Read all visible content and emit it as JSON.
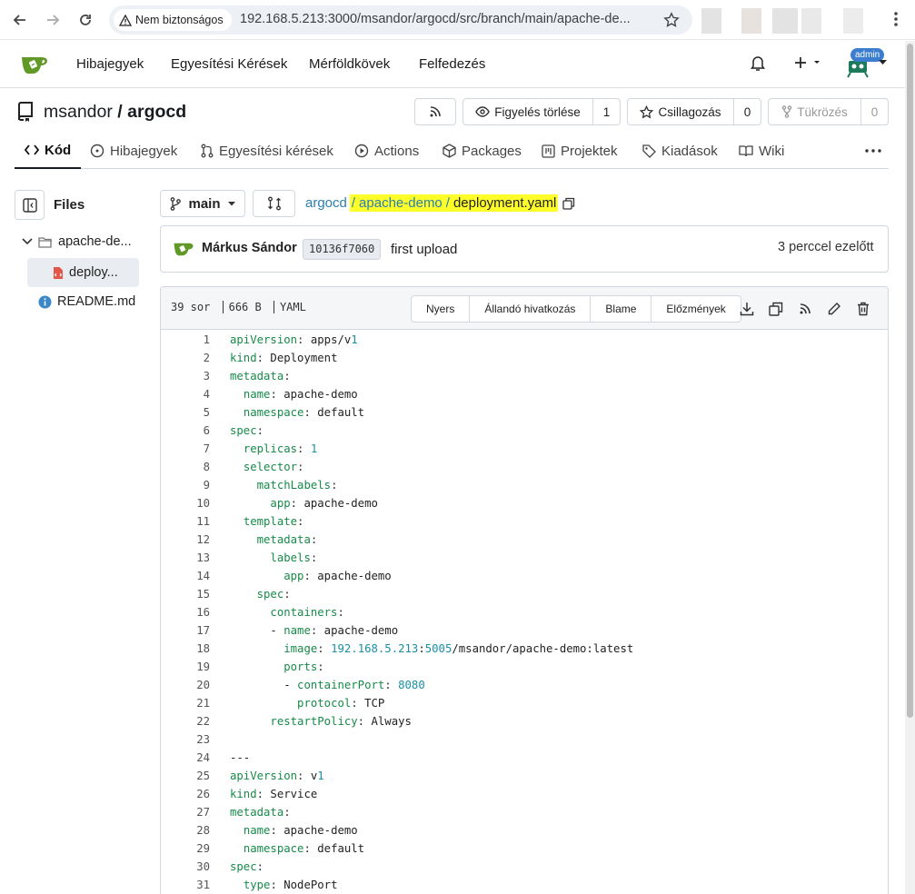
{
  "browser": {
    "security_label": "Nem biztonságos",
    "url": "192.168.5.213:3000/msandor/argocd/src/branch/main/apache-de..."
  },
  "nav": {
    "issues": "Hibajegyek",
    "pulls": "Egyesítési Kérések",
    "milestones": "Mérföldkövek",
    "explore": "Felfedezés",
    "admin_badge": "admin"
  },
  "repo": {
    "owner": "msandor",
    "sep": "/",
    "name": "argocd",
    "unwatch_label": "Figyelés törlése",
    "watch_count": "1",
    "star_label": "Csillagozás",
    "star_count": "0",
    "mirror_label": "Tükrözés",
    "mirror_count": "0"
  },
  "tabs": [
    "Kód",
    "Hibajegyek",
    "Egyesítési kérések",
    "Actions",
    "Packages",
    "Projektek",
    "Kiadások",
    "Wiki"
  ],
  "sidebar": {
    "title": "Files",
    "folder": "apache-de...",
    "file_active": "deploy...",
    "readme": "README.md"
  },
  "branch": "main",
  "breadcrumb": {
    "root": "argocd",
    "folder": "apache-demo",
    "file": "deployment.yaml",
    "sep": "/"
  },
  "commit": {
    "author": "Márkus Sándor",
    "sha": "10136f7060",
    "message": "first upload",
    "time": "3 perccel ezelőtt"
  },
  "file": {
    "lines": "39 sor",
    "size": "666 B",
    "lang": "YAML",
    "btn_raw": "Nyers",
    "btn_permalink": "Állandó hivatkozás",
    "btn_blame": "Blame",
    "btn_history": "Előzmények"
  },
  "code": [
    "apiVersion: apps/v1",
    "kind: Deployment",
    "metadata:",
    "  name: apache-demo",
    "  namespace: default",
    "spec:",
    "  replicas: 1",
    "  selector:",
    "    matchLabels:",
    "      app: apache-demo",
    "  template:",
    "    metadata:",
    "      labels:",
    "        app: apache-demo",
    "    spec:",
    "      containers:",
    "      - name: apache-demo",
    "        image: 192.168.5.213:5005/msandor/apache-demo:latest",
    "        ports:",
    "        - containerPort: 8080",
    "          protocol: TCP",
    "      restartPolicy: Always",
    "",
    "---",
    "apiVersion: v1",
    "kind: Service",
    "metadata:",
    "  name: apache-demo",
    "  namespace: default",
    "spec:",
    "  type: NodePort"
  ],
  "colors": {
    "highlight": "#ffff29",
    "gitea_green": "#609926",
    "key": "#178a4a",
    "number": "#1a8fa5",
    "link": "#2a7db3"
  }
}
